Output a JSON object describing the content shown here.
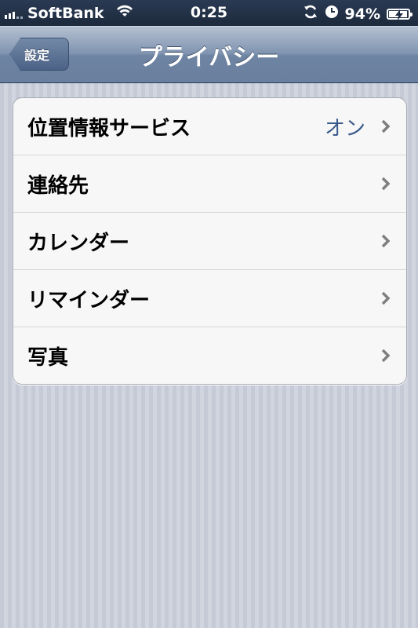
{
  "status_bar": {
    "carrier": "SoftBank",
    "time": "0:25",
    "battery_percent": "94%",
    "battery_level": 0.94
  },
  "nav": {
    "back_label": "設定",
    "title": "プライバシー"
  },
  "rows": [
    {
      "label": "位置情報サービス",
      "value": "オン"
    },
    {
      "label": "連絡先",
      "value": ""
    },
    {
      "label": "カレンダー",
      "value": ""
    },
    {
      "label": "リマインダー",
      "value": ""
    },
    {
      "label": "写真",
      "value": ""
    }
  ],
  "colors": {
    "nav_bar": "#7a8eab",
    "status_bar": "#1f2d42",
    "value_text": "#3a5a8c",
    "chevron": "#7f7f7f"
  }
}
